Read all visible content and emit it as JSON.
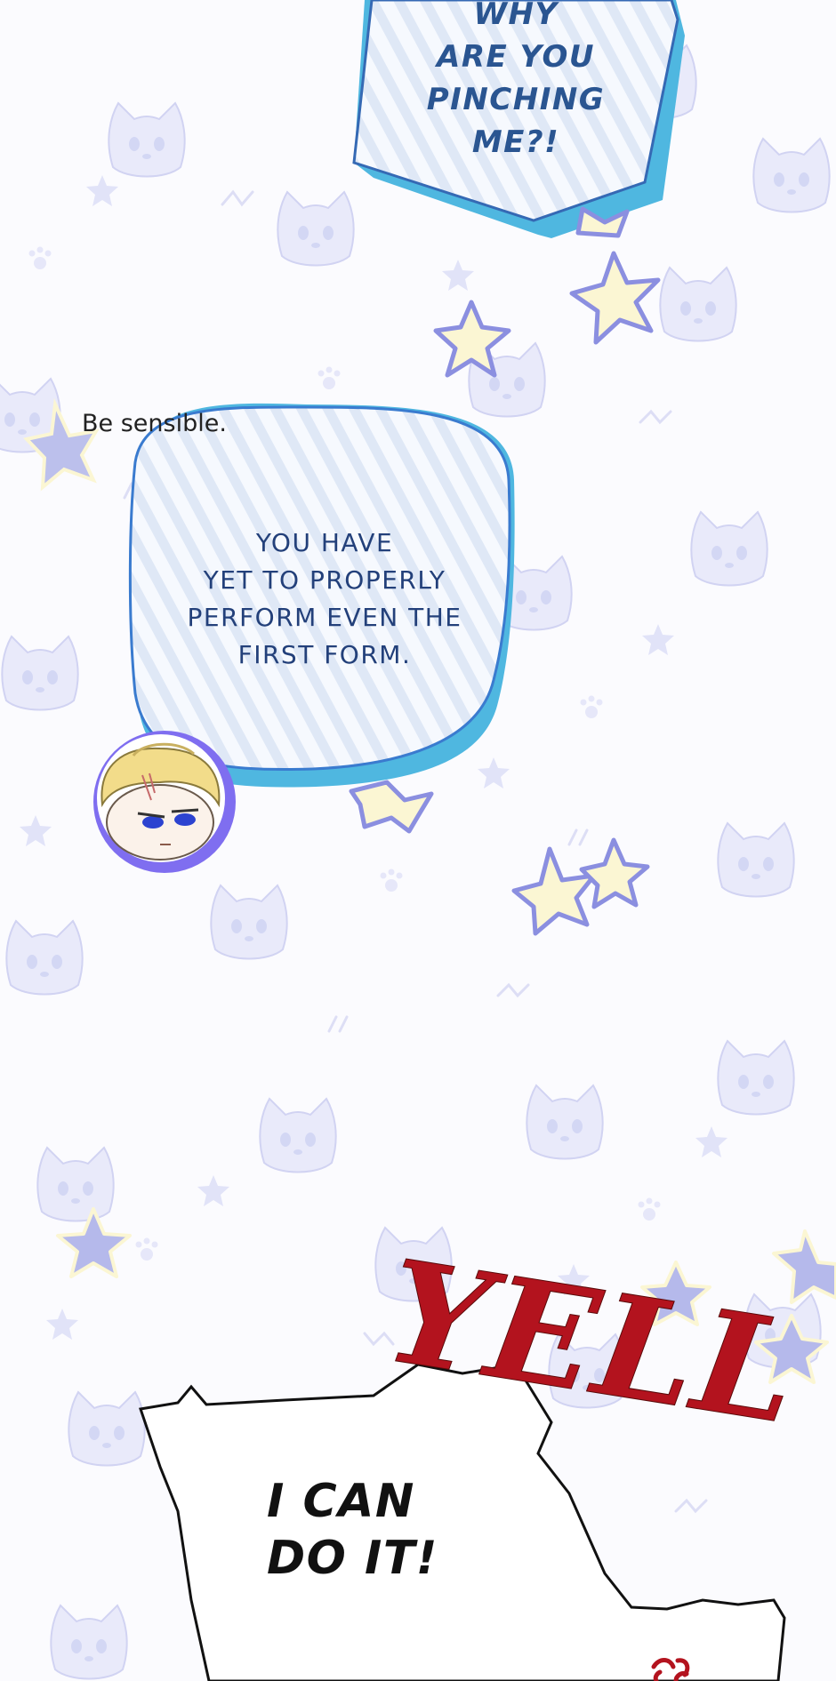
{
  "speech_top": {
    "lines": [
      "WHY",
      "ARE YOU",
      "PINCHING",
      "ME?!"
    ]
  },
  "narration": {
    "text": "Be sensible."
  },
  "speech_middle": {
    "lines": [
      "YOU HAVE",
      "YET TO PROPERLY",
      "PERFORM EVEN THE",
      "FIRST FORM."
    ]
  },
  "sfx": {
    "text": "YELL"
  },
  "speech_bottom": {
    "lines": [
      "I CAN",
      "DO IT!"
    ]
  },
  "colors": {
    "background": "#fbfbfe",
    "bubble_border": "#3a7bcf",
    "bubble_shadow": "#4fb7e0",
    "bubble_stripe": "#dde7f5",
    "star_yellow": "#fbf6d3",
    "star_outline": "#8b8fe0",
    "sfx_red": "#b3131e"
  }
}
